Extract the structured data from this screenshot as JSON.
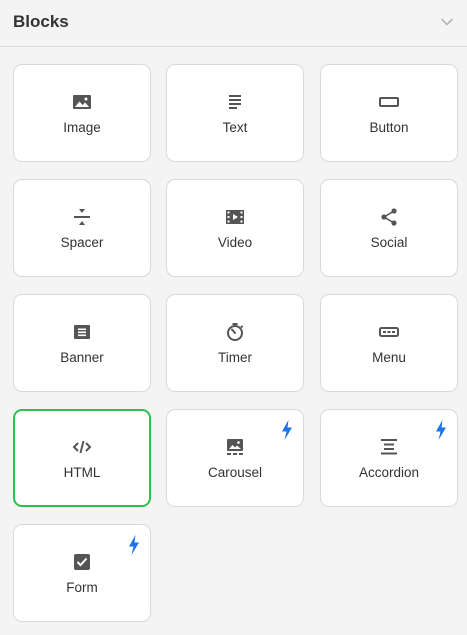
{
  "header": {
    "title": "Blocks",
    "collapse_icon": "chevron-down-icon"
  },
  "blocks": [
    {
      "label": "Image",
      "icon": "image-icon",
      "premium": false,
      "selected": false
    },
    {
      "label": "Text",
      "icon": "text-icon",
      "premium": false,
      "selected": false
    },
    {
      "label": "Button",
      "icon": "button-icon",
      "premium": false,
      "selected": false
    },
    {
      "label": "Spacer",
      "icon": "spacer-icon",
      "premium": false,
      "selected": false
    },
    {
      "label": "Video",
      "icon": "video-icon",
      "premium": false,
      "selected": false
    },
    {
      "label": "Social",
      "icon": "share-icon",
      "premium": false,
      "selected": false
    },
    {
      "label": "Banner",
      "icon": "banner-icon",
      "premium": false,
      "selected": false
    },
    {
      "label": "Timer",
      "icon": "timer-icon",
      "premium": false,
      "selected": false
    },
    {
      "label": "Menu",
      "icon": "menu-icon",
      "premium": false,
      "selected": false
    },
    {
      "label": "HTML",
      "icon": "code-icon",
      "premium": false,
      "selected": true
    },
    {
      "label": "Carousel",
      "icon": "carousel-icon",
      "premium": true,
      "selected": false
    },
    {
      "label": "Accordion",
      "icon": "accordion-icon",
      "premium": true,
      "selected": false
    },
    {
      "label": "Form",
      "icon": "checkbox-icon",
      "premium": true,
      "selected": false
    }
  ],
  "colors": {
    "selected_border": "#2fbf4e",
    "premium_bolt": "#1a73e8",
    "icon": "#555555"
  }
}
